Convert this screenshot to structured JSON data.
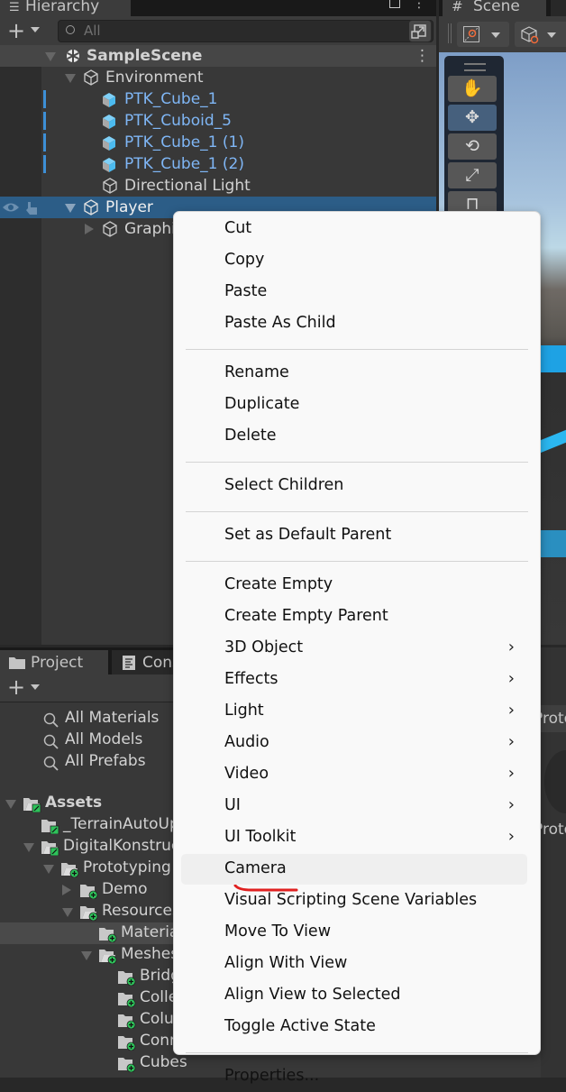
{
  "hierarchy": {
    "tab_label": "Hierarchy",
    "search_placeholder": "All",
    "rows": [
      {
        "label": "SampleScene"
      },
      {
        "label": "Environment"
      },
      {
        "label": "PTK_Cube_1"
      },
      {
        "label": "PTK_Cuboid_5"
      },
      {
        "label": "PTK_Cube_1 (1)"
      },
      {
        "label": "PTK_Cube_1 (2)"
      },
      {
        "label": "Directional Light"
      },
      {
        "label": "Player"
      },
      {
        "label": "Graphics"
      }
    ],
    "selected": "Player"
  },
  "scene": {
    "tab_label": "Scene",
    "tools": [
      "hand",
      "move",
      "rotate",
      "scale",
      "rect"
    ],
    "active_tool": "move"
  },
  "project": {
    "tab_label": "Project",
    "console_tab_label": "Console",
    "favorites": [
      {
        "label": "All Materials"
      },
      {
        "label": "All Models"
      },
      {
        "label": "All Prefabs"
      }
    ],
    "tree": [
      {
        "label": "Assets"
      },
      {
        "label": "_TerrainAutoUpgrade"
      },
      {
        "label": "DigitalKonstruct"
      },
      {
        "label": "Prototyping"
      },
      {
        "label": "Demo"
      },
      {
        "label": "Resources"
      },
      {
        "label": "Materials"
      },
      {
        "label": "Meshes"
      },
      {
        "label": "Bridges"
      },
      {
        "label": "Collections"
      },
      {
        "label": "Columns"
      },
      {
        "label": "Connectors"
      },
      {
        "label": "Cubes"
      }
    ],
    "right_pane_labels": [
      "Prototyping",
      "Prototyping"
    ]
  },
  "context_menu": {
    "groups": [
      [
        {
          "label": "Cut"
        },
        {
          "label": "Copy"
        },
        {
          "label": "Paste"
        },
        {
          "label": "Paste As Child"
        }
      ],
      [
        {
          "label": "Rename"
        },
        {
          "label": "Duplicate"
        },
        {
          "label": "Delete"
        }
      ],
      [
        {
          "label": "Select Children"
        }
      ],
      [
        {
          "label": "Set as Default Parent"
        }
      ],
      [
        {
          "label": "Create Empty"
        },
        {
          "label": "Create Empty Parent"
        },
        {
          "label": "3D Object",
          "submenu": true
        },
        {
          "label": "Effects",
          "submenu": true
        },
        {
          "label": "Light",
          "submenu": true
        },
        {
          "label": "Audio",
          "submenu": true
        },
        {
          "label": "Video",
          "submenu": true
        },
        {
          "label": "UI",
          "submenu": true
        },
        {
          "label": "UI Toolkit",
          "submenu": true
        },
        {
          "label": "Camera",
          "highlighted": true
        },
        {
          "label": "Visual Scripting Scene Variables"
        },
        {
          "label": "Move To View"
        },
        {
          "label": "Align With View"
        },
        {
          "label": "Align View to Selected"
        },
        {
          "label": "Toggle Active State"
        }
      ],
      [
        {
          "label": "Properties..."
        }
      ]
    ],
    "submenu_arrow": "›",
    "annotation_color": "#e02020"
  },
  "colors": {
    "prefab_text": "#7fb6f5",
    "selection": "#2c5d87",
    "folder_badge_green": "#2ec25a"
  }
}
